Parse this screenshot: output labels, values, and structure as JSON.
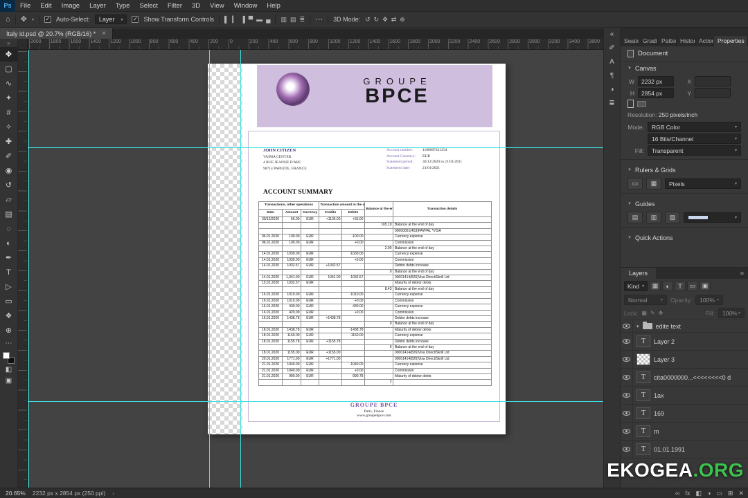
{
  "colors": {
    "band_purple": "#cfbedd",
    "doc_accent_purple": "#7b4fa0",
    "guide_cyan": "#3fe0e0",
    "watermark_green": "#3ec24e"
  },
  "menubar": {
    "logo": "Ps",
    "items": [
      "File",
      "Edit",
      "Image",
      "Layer",
      "Type",
      "Select",
      "Filter",
      "3D",
      "View",
      "Window",
      "Help"
    ]
  },
  "options": {
    "home_icon": "⌂",
    "tool_icon": "✥",
    "auto_select_label": "Auto-Select:",
    "auto_select_value": "Layer",
    "auto_select_checked": "✓",
    "show_transform_label": "Show Transform Controls",
    "show_transform_checked": "✓",
    "more_icon": "⋯",
    "mode_label": "3D Mode:",
    "align_icons": [
      {
        "name": "align-left-icon",
        "glyph": "▌"
      },
      {
        "name": "align-center-horizontal-icon",
        "glyph": "▎"
      },
      {
        "name": "align-right-icon",
        "glyph": "▐"
      },
      {
        "name": "align-top-icon",
        "glyph": "▀"
      },
      {
        "name": "align-center-vertical-icon",
        "glyph": "▬"
      },
      {
        "name": "align-bottom-icon",
        "glyph": "▄"
      }
    ],
    "distribute_icons": [
      {
        "name": "distribute-horizontal-icon",
        "glyph": "▥"
      },
      {
        "name": "distribute-vertical-icon",
        "glyph": "▤"
      },
      {
        "name": "distribute-spacing-icon",
        "glyph": "≣"
      }
    ],
    "mode_icons": [
      {
        "name": "3d-rotate-icon",
        "glyph": "↺"
      },
      {
        "name": "3d-roll-icon",
        "glyph": "↻"
      },
      {
        "name": "3d-drag-icon",
        "glyph": "✥"
      },
      {
        "name": "3d-slide-icon",
        "glyph": "⇄"
      },
      {
        "name": "3d-scale-icon",
        "glyph": "⊕"
      }
    ]
  },
  "tab": {
    "title": "Italy id.psd @ 20.7% (RGB/16) *",
    "close": "×"
  },
  "ruler": {
    "labels": [
      "2000",
      "1800",
      "1600",
      "1400",
      "1200",
      "1000",
      "800",
      "600",
      "400",
      "200",
      "0",
      "200",
      "400",
      "600",
      "800",
      "1000",
      "1200",
      "1400",
      "1600",
      "1800",
      "2000",
      "2200",
      "2400",
      "2600",
      "2800",
      "3000",
      "3200",
      "3400",
      "3600",
      "3800"
    ]
  },
  "tools": [
    {
      "name": "move-tool",
      "glyph": "✥"
    },
    {
      "name": "marquee-tool",
      "glyph": "▢"
    },
    {
      "name": "lasso-tool",
      "glyph": "∿"
    },
    {
      "name": "quick-selection-tool",
      "glyph": "✦"
    },
    {
      "name": "crop-tool",
      "glyph": "#"
    },
    {
      "name": "eyedropper-tool",
      "glyph": "✧"
    },
    {
      "name": "healing-brush-tool",
      "glyph": "✚"
    },
    {
      "name": "brush-tool",
      "glyph": "✐"
    },
    {
      "name": "clone-stamp-tool",
      "glyph": "◉"
    },
    {
      "name": "history-brush-tool",
      "glyph": "↺"
    },
    {
      "name": "eraser-tool",
      "glyph": "▱"
    },
    {
      "name": "gradient-tool",
      "glyph": "▤"
    },
    {
      "name": "blur-tool",
      "glyph": "◌"
    },
    {
      "name": "dodge-tool",
      "glyph": "◐"
    },
    {
      "name": "pen-tool",
      "glyph": "✒"
    },
    {
      "name": "type-tool",
      "glyph": "T"
    },
    {
      "name": "path-selection-tool",
      "glyph": "▷"
    },
    {
      "name": "shape-tool",
      "glyph": "▭"
    },
    {
      "name": "hand-tool",
      "glyph": "❖"
    },
    {
      "name": "zoom-tool",
      "glyph": "⊕"
    }
  ],
  "dock_icons": [
    {
      "name": "collapse-panels-icon",
      "glyph": "«"
    },
    {
      "name": "brush-settings-panel-icon",
      "glyph": "✐"
    },
    {
      "name": "character-panel-icon",
      "glyph": "A"
    },
    {
      "name": "paragraph-panel-icon",
      "glyph": "¶"
    },
    {
      "name": "adjustments-panel-icon",
      "glyph": "◑"
    },
    {
      "name": "info-panel-icon",
      "glyph": "≣"
    }
  ],
  "doc": {
    "brand_word1": "GROUPE",
    "brand_word2": "BPCE",
    "customer_name": "JOHN CITIZEN",
    "customer_address": [
      "VAIMA CENTER",
      "4 RUE JEANNE D'ARC",
      "98714 PAPEETE, FRANCE"
    ],
    "meta": [
      {
        "label": "Account number:",
        "value": "1180007421254"
      },
      {
        "label": "Account Currency:",
        "value": "EUR"
      },
      {
        "label": "Statement period:",
        "value": "30/12/2020 to 21/01/2021"
      },
      {
        "label": "Statement date:",
        "value": "21/01/2021"
      }
    ],
    "summary_title": "ACCOUNT SUMMARY",
    "table": {
      "group_headers": [
        "Transactions, other operations",
        "Transaction amount in the account currency",
        "Balance at the end",
        "Transaction details"
      ],
      "sub_headers": [
        "Date",
        "Amount",
        "Currency",
        "Credits",
        "Debits"
      ],
      "rows": [
        [
          "30/12/2020",
          "55.00",
          "EUR",
          "+1135.00",
          "+55.00",
          "",
          ""
        ],
        [
          "",
          "",
          "",
          "",
          "",
          "165.10",
          "Balance at the end of day"
        ],
        [
          "",
          "",
          "",
          "",
          "",
          "",
          "00000001(453)PAYPAL *VISA"
        ],
        [
          "06.01.2020",
          "100.00",
          "EUR",
          "",
          "-100.00",
          "",
          "Currency expense"
        ],
        [
          "06.01.2020",
          "100.00",
          "EUR",
          "",
          "+0.00",
          "",
          "Commission"
        ],
        [
          "",
          "",
          "",
          "",
          "",
          "2.90",
          "Balance at the end of day"
        ],
        [
          "14.01.2020",
          "1030.00",
          "EUR",
          "",
          "-1030.00",
          "",
          "Currency expense"
        ],
        [
          "14.01.2020",
          "1030.00",
          "EUR",
          "",
          "+0.00",
          "",
          "Commission"
        ],
        [
          "14.01.2020",
          "1032.57",
          "EUR",
          "+1032.57",
          "",
          "",
          "Debtor debts increase"
        ],
        [
          "",
          "",
          "",
          "",
          "",
          "0",
          "Balance at the end of day"
        ],
        [
          "14.01.2020",
          "1,041.00",
          "EUR",
          "1041.00",
          "-1032.57",
          "",
          "00001414(826)Visa Direct/Skrill Ltd"
        ],
        [
          "15.01.2020",
          "1032.57",
          "EUR",
          "",
          "",
          "",
          "Maturity of debtor debts"
        ],
        [
          "",
          "",
          "",
          "",
          "",
          "8.43",
          "Balance at the end of day"
        ],
        [
          "16.01.2020",
          "1010.00",
          "EUR",
          "",
          "-1010.00",
          "",
          "Currency expense"
        ],
        [
          "16.01.2020",
          "1010.00",
          "EUR",
          "",
          "+0.00",
          "",
          "Commission"
        ],
        [
          "16.01.2020",
          "430.00",
          "EUR",
          "",
          "-430.00",
          "",
          "Currency expense"
        ],
        [
          "16.01.2020",
          "420.00",
          "EUR",
          "",
          "+0.00",
          "",
          "Commission"
        ],
        [
          "16.01.2020",
          "1438.78",
          "EUR",
          "+1438.78",
          "",
          "",
          "Debtor debts increase"
        ],
        [
          "",
          "",
          "",
          "",
          "",
          "0",
          "Balance at the end of day"
        ],
        [
          "18.01.2020",
          "1438.78",
          "EUR",
          "",
          "-1438.78",
          "",
          "Maturity of debtor debts"
        ],
        [
          "18.01.2020",
          "1160.00",
          "EUR",
          "",
          "-1160.00",
          "",
          "Currency expense"
        ],
        [
          "18.01.2020",
          "1155.78",
          "EUR",
          "+1155.78",
          "",
          "",
          "Debtor debts increase"
        ],
        [
          "",
          "",
          "",
          "",
          "",
          "0",
          "Balance at the end of day"
        ],
        [
          "18.01.2020",
          "1155.00",
          "EUR",
          "+1155.00",
          "",
          "",
          "00001414(826)Visa Direct/Skrill Ltd"
        ],
        [
          "20.01.2020",
          "1771.00",
          "EUR",
          "+1771.00",
          "",
          "",
          "00001414(826)Visa Direct/Skrill Ltd"
        ],
        [
          "21.01.2020",
          "1040.00",
          "EUR",
          "",
          "-1040.00",
          "",
          "Currency expense"
        ],
        [
          "21.01.2020",
          "1040.00",
          "EUR",
          "",
          "+0.00",
          "",
          "Commission"
        ],
        [
          "21.01.2020",
          "990.00",
          "EUR",
          "",
          "-990.78",
          "",
          "Maturity of debtor debts"
        ],
        [
          "",
          "",
          "",
          "",
          "",
          "2",
          ""
        ]
      ]
    },
    "footer_brand": "GROUPE BPCE",
    "footer_city": "Paris, France",
    "footer_site": "www.groupebpce.com"
  },
  "properties": {
    "tabs": [
      "Swatches",
      "Gradients",
      "Patterns",
      "History",
      "Actions",
      "Properties"
    ],
    "active_tab": "Properties",
    "header": "Document",
    "canvas_section": "Canvas",
    "w_label": "W",
    "w_value": "2232 px",
    "x_label": "X",
    "h_label": "H",
    "h_value": "2854 px",
    "y_label": "Y",
    "resolution_label": "Resolution:",
    "resolution_value": "250 pixels/inch",
    "mode_label": "Mode:",
    "mode_value": "RGB Color",
    "depth_value": "16 Bits/Channel",
    "fill_label": "Fill:",
    "fill_value": "Transparent",
    "rulers_section": "Rulers & Grids",
    "units_value": "Pixels",
    "guides_section": "Guides",
    "quick_actions_section": "Quick Actions"
  },
  "layers_panel": {
    "tab": "Layers",
    "kind_value": "Kind",
    "blend_value": "Normal",
    "opacity_label": "Opacity:",
    "opacity_value": "100%",
    "lock_label": "Lock:",
    "fill_label": "Fill:",
    "fill_value": "100%",
    "filter_icons": [
      {
        "name": "pixel-layer-filter-icon",
        "glyph": "▦"
      },
      {
        "name": "adjustment-layer-filter-icon",
        "glyph": "◐"
      },
      {
        "name": "type-layer-filter-icon",
        "glyph": "T"
      },
      {
        "name": "shape-layer-filter-icon",
        "glyph": "▭"
      },
      {
        "name": "smart-object-filter-icon",
        "glyph": "▣"
      }
    ],
    "items": [
      {
        "kind": "group",
        "name": "edite text"
      },
      {
        "kind": "text",
        "name": "Layer 2"
      },
      {
        "kind": "pixel",
        "name": "Layer 3"
      },
      {
        "kind": "text",
        "name": "cita0000000...<<<<<<<<0 d"
      },
      {
        "kind": "text",
        "name": "1ax"
      },
      {
        "kind": "text",
        "name": "169"
      },
      {
        "kind": "text",
        "name": "m"
      },
      {
        "kind": "text",
        "name": "01.01.1991"
      }
    ],
    "footer_icons": [
      {
        "name": "link-layers-icon",
        "glyph": "∞"
      },
      {
        "name": "layer-effects-icon",
        "glyph": "fx"
      },
      {
        "name": "layer-mask-icon",
        "glyph": "◧"
      },
      {
        "name": "adjustment-layer-icon",
        "glyph": "◑"
      },
      {
        "name": "layer-group-icon",
        "glyph": "▭"
      },
      {
        "name": "new-layer-icon",
        "glyph": "⊞"
      },
      {
        "name": "delete-layer-icon",
        "glyph": "✕"
      }
    ]
  },
  "statusbar": {
    "zoom": "20.65%",
    "doc_info": "2232 px x 2854 px (250 ppi)",
    "chevron": "›"
  },
  "watermark": {
    "text1": "EKOGEA",
    "text2": ".ORG"
  }
}
